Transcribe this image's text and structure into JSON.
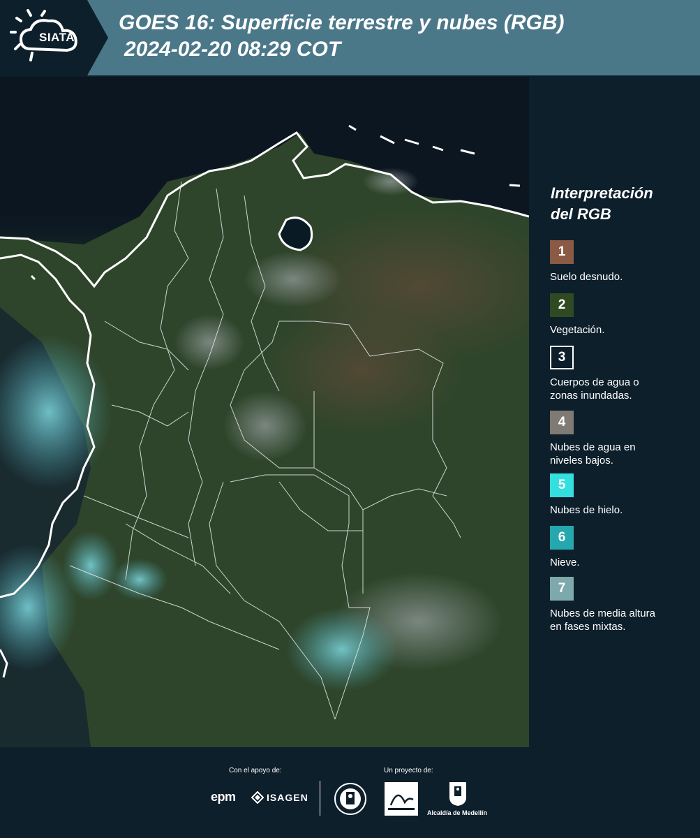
{
  "header": {
    "logo": "SIATA",
    "title_line1": "GOES 16: Superficie terrestre y nubes (RGB)",
    "title_line2": "2024-02-20 08:29 COT"
  },
  "map": {
    "product": "GOES 16 true color RGB over Colombia"
  },
  "legend": {
    "title_line1": "Interpretación",
    "title_line2": "del RGB",
    "items": [
      {
        "number": "1",
        "label_line1": "Suelo desnudo.",
        "label_line2": "",
        "color": "#8a5a45",
        "border": "#8a5a45"
      },
      {
        "number": "2",
        "label_line1": "Vegetación.",
        "label_line2": "",
        "color": "#2f4a22",
        "border": "#2f4a22"
      },
      {
        "number": "3",
        "label_line1": "Cuerpos de agua o",
        "label_line2": "zonas inundadas.",
        "color": "#0d1f2b",
        "border": "#ffffff"
      },
      {
        "number": "4",
        "label_line1": "Nubes de agua en",
        "label_line2": "niveles bajos.",
        "color": "#7f7a73",
        "border": "#7f7a73"
      },
      {
        "number": "5",
        "label_line1": "Nubes de hielo.",
        "label_line2": "",
        "color": "#34dfe0",
        "border": "#34dfe0"
      },
      {
        "number": "6",
        "label_line1": "Nieve.",
        "label_line2": "",
        "color": "#25a8ad",
        "border": "#25a8ad"
      },
      {
        "number": "7",
        "label_line1": "Nubes de media altura",
        "label_line2": "en fases mixtas.",
        "color": "#7da8ac",
        "border": "#7da8ac"
      }
    ]
  },
  "footer": {
    "support_label": "Con el apoyo de:",
    "project_label": "Un proyecto de:",
    "epm": "epm",
    "isagen": "ISAGEN",
    "alcaldia": "Alcaldía de Medellín"
  }
}
